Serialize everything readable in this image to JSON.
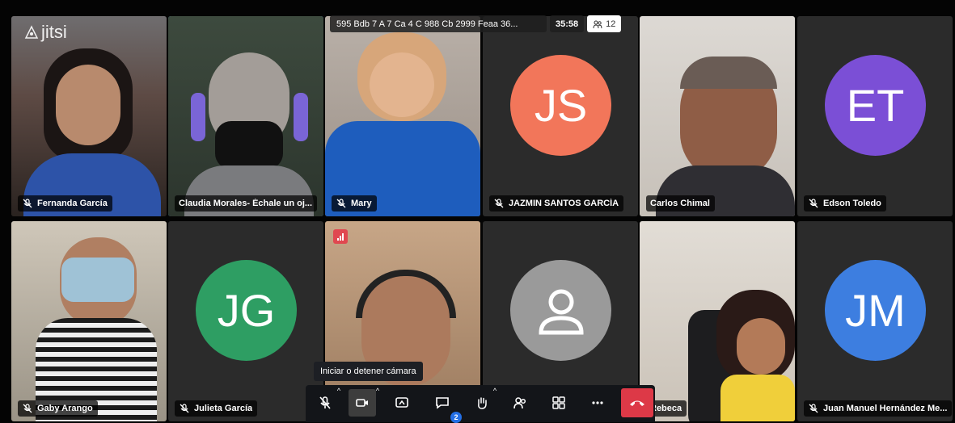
{
  "branding": {
    "logo_text": "jitsi"
  },
  "header": {
    "subject": "595 Bdb 7 A 7 Ca 4 C 988 Cb 2999 Feaa 36...",
    "timer": "35:58",
    "participant_count": "12"
  },
  "tiles": [
    {
      "name": "Fernanda García",
      "muted": true,
      "type": "video"
    },
    {
      "name": "Claudia Morales- Échale un oj...",
      "muted": false,
      "type": "video",
      "active": true
    },
    {
      "name": "Mary",
      "muted": true,
      "type": "video"
    },
    {
      "name": "JAZMIN SANTOS GARCÍA",
      "muted": true,
      "type": "avatar",
      "initials": "JS",
      "color": "#f2765a"
    },
    {
      "name": "Carlos Chimal",
      "muted": false,
      "type": "video"
    },
    {
      "name": "Edson Toledo",
      "muted": true,
      "type": "avatar",
      "initials": "ET",
      "color": "#7b4fd6"
    },
    {
      "name": "Gaby Arango",
      "muted": true,
      "type": "video"
    },
    {
      "name": "Julieta García",
      "muted": true,
      "type": "avatar",
      "initials": "JG",
      "color": "#2e9e63"
    },
    {
      "name": "",
      "muted": false,
      "type": "video",
      "poor_connection": true
    },
    {
      "name": "",
      "muted": false,
      "type": "avatar",
      "initials": "",
      "color": "#9a9a9a",
      "generic_user": true
    },
    {
      "name": "Rebeca",
      "muted": false,
      "type": "video"
    },
    {
      "name": "Juan Manuel Hernández Me...",
      "muted": true,
      "type": "avatar",
      "initials": "JM",
      "color": "#3d7ee0"
    }
  ],
  "toolbar": {
    "tooltip": "Iniciar o detener cámara",
    "chat_badge": "2",
    "buttons": [
      "microphone-icon",
      "camera-icon",
      "screen-share-icon",
      "chat-icon",
      "raise-hand-icon",
      "participants-icon",
      "tile-view-icon",
      "more-icon",
      "hangup-icon"
    ]
  },
  "colors": {
    "active_border": "#3f7bd4",
    "hangup": "#dd3947",
    "badge": "#246fe5"
  }
}
